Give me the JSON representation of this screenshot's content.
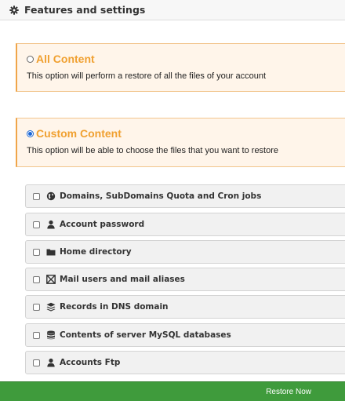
{
  "header": {
    "icon": "gear-icon",
    "title": "Features and settings"
  },
  "options": {
    "all_content": {
      "title": "All Content",
      "description": "This option will perform a restore of all the files of your account",
      "selected": false
    },
    "custom_content": {
      "title": "Custom Content",
      "description": "This option will be able to choose the files that you want to restore",
      "selected": true
    }
  },
  "items": [
    {
      "label": "Domains, SubDomains Quota and Cron jobs",
      "icon": "globe-icon",
      "checked": false
    },
    {
      "label": "Account password",
      "icon": "user-icon",
      "checked": false
    },
    {
      "label": "Home directory",
      "icon": "folder-icon",
      "checked": false
    },
    {
      "label": "Mail users and mail aliases",
      "icon": "mail-icon",
      "checked": false
    },
    {
      "label": "Records in DNS domain",
      "icon": "stack-icon",
      "checked": false
    },
    {
      "label": "Contents of server MySQL databases",
      "icon": "database-icon",
      "checked": false
    },
    {
      "label": "Accounts Ftp",
      "icon": "user-icon",
      "checked": false
    }
  ],
  "footer": {
    "restore_label": "Restore Now"
  },
  "colors": {
    "accent": "#f0a030",
    "option_bg": "#fff5ea",
    "restore_bar": "#3f9b3c",
    "radio_selected": "#1a66d6"
  }
}
